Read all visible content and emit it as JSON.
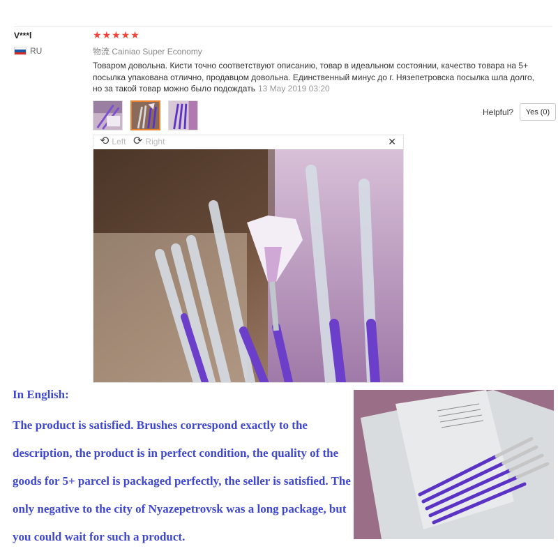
{
  "review": {
    "username": "V***l",
    "country": "RU",
    "flag_icon": "russia-flag-icon",
    "rating": 5,
    "stars": "★★★★★",
    "logistics_label": "物流",
    "logistics_value": "Cainiao Super Economy",
    "text": "Товаром довольна. Кисти точно соответствуют описанию, товар в идеальном состоянии, качество товара на 5+ посылка упакована отлично, продавцом довольна. Единственный минус до г. Нязепетровска посылка шла долго, но за такой товар можно было подождать",
    "date": "13 May 2019 03:20",
    "helpful_label": "Helpful?",
    "yes_button": "Yes (0)"
  },
  "viewer": {
    "rotate_left": "Left",
    "rotate_right": "Right",
    "rotate_left_icon": "rotate-left-icon",
    "rotate_right_icon": "rotate-right-icon",
    "close_icon": "close-icon",
    "close_glyph": "✕"
  },
  "english": {
    "heading": "In English:",
    "body": "The product is satisfied. Brushes correspond exactly to the description, the product is in perfect condition, the quality of the goods for 5+ parcel is packaged perfectly, the seller is satisfied. The only negative to the city of Nyazepetrovsk was a long package, but you could wait for such a product."
  },
  "colors": {
    "star": "#f44336",
    "english_text": "#3e47cf",
    "thumb_active_border": "#e8812f",
    "brush_handle": "#6b3fc9"
  }
}
